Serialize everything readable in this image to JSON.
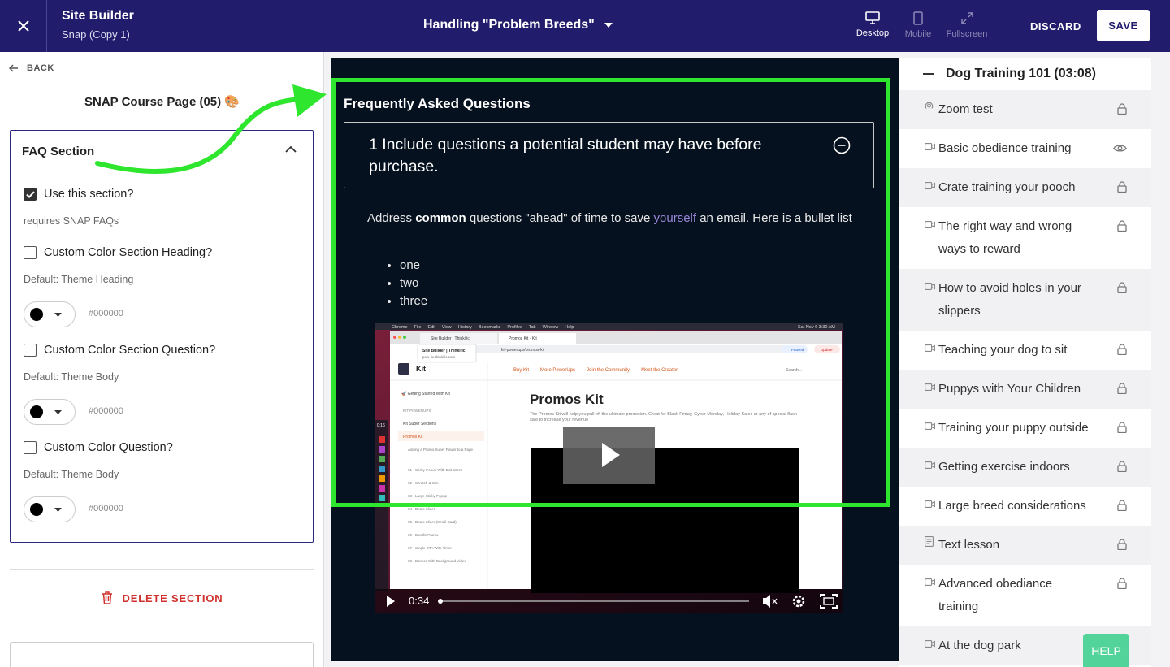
{
  "topbar": {
    "title": "Site Builder",
    "subtitle": "Snap (Copy 1)",
    "page_selector": "Handling \"Problem Breeds\"",
    "views": [
      {
        "label": "Desktop",
        "icon": "desktop-icon",
        "active": true
      },
      {
        "label": "Mobile",
        "icon": "mobile-icon",
        "active": false
      },
      {
        "label": "Fullscreen",
        "icon": "fullscreen-icon",
        "active": false
      }
    ],
    "discard_label": "DISCARD",
    "save_label": "SAVE"
  },
  "left": {
    "back_label": "BACK",
    "page_title": "SNAP Course Page (05) 🎨",
    "section": {
      "title": "FAQ Section",
      "use_section": {
        "label": "Use this section?",
        "checked": true,
        "hint": "requires SNAP FAQs"
      },
      "options": [
        {
          "label": "Custom Color Section Heading?",
          "checked": false,
          "default": "Default: Theme Heading",
          "color": "#000000"
        },
        {
          "label": "Custom Color Section Question?",
          "checked": false,
          "default": "Default: Theme Body",
          "color": "#000000"
        },
        {
          "label": "Custom Color Question?",
          "checked": false,
          "default": "Default: Theme Body",
          "color": "#000000"
        }
      ]
    },
    "delete_label": "DELETE SECTION"
  },
  "preview": {
    "faq_title": "Frequently Asked Questions",
    "question": "1 Include questions a potential student may have before purchase.",
    "answer": {
      "part1": "Address ",
      "bold": "common",
      "part2": " questions \"ahead\" of time to save ",
      "link": "yourself",
      "part3": " an email. Here is a bullet list"
    },
    "bullets": [
      "one",
      "two",
      "three"
    ],
    "video": {
      "time": "0:34",
      "progress": 0.0,
      "page_heading": "Promos Kit",
      "page_desc": "The Promos Kit will help you pull off the ultimate promotion. Great for Black Friday, Cyber Monday, Holiday Sales or any of special flash sale to increase your revenue",
      "menu": [
        "Chrome",
        "File",
        "Edit",
        "View",
        "History",
        "Bookmarks",
        "Profiles",
        "Tab",
        "Window",
        "Help"
      ],
      "clock": "Sat Nov 6  3:30 AM",
      "tabs": [
        "Site Builder | Thinkific",
        "Promos Kit - Kit"
      ],
      "url": "kit-powerups/promos-kit",
      "tooltip_title": "Site Builder | Thinkific",
      "tooltip_url": "pow-fix.thinkific.com",
      "brand": "Kit",
      "nav": [
        "Buy Kit",
        "More PowerUps",
        "Join the Community",
        "Meet the Creator"
      ],
      "search": "Search...",
      "paused": "Paused",
      "update": "Update",
      "side_start": "🚀 Getting Started With Kit",
      "side_heading": "KIT POWERUPS",
      "side_items": [
        "Kit Super Sections",
        "Promos Kit"
      ],
      "side_sub": [
        "Adding a Promo Super Power to a Page",
        "01 - Sticky Popup With Exit Intent",
        "02 - Scratch & Win",
        "03 - Large Sticky Popup",
        "04 - Deals Slider",
        "05 - Deals Slider (Small Card)",
        "06 - Bundle Promo",
        "07 - Single CTA With Timer",
        "08 - Banner With Background Video"
      ],
      "dock_time": "0:16"
    }
  },
  "curriculum": {
    "chapter": "Dog Training 101 (03:08)",
    "lessons": [
      {
        "name": "Zoom test",
        "icon": "zoom-icon",
        "status": "lock-icon"
      },
      {
        "name": "Basic obedience training",
        "icon": "video-icon",
        "status": "eye-icon"
      },
      {
        "name": "Crate training your pooch",
        "icon": "video-icon",
        "status": "lock-icon"
      },
      {
        "name": "The right way and wrong ways to reward",
        "icon": "video-icon",
        "status": "lock-icon"
      },
      {
        "name": "How to avoid holes in your slippers",
        "icon": "video-icon",
        "status": "lock-icon"
      },
      {
        "name": "Teaching your dog to sit",
        "icon": "video-icon",
        "status": "lock-icon"
      },
      {
        "name": "Puppys with Your Children",
        "icon": "video-icon",
        "status": "lock-icon"
      },
      {
        "name": "Training your puppy outside",
        "icon": "video-icon",
        "status": "lock-icon"
      },
      {
        "name": "Getting exercise indoors",
        "icon": "video-icon",
        "status": "lock-icon"
      },
      {
        "name": "Large breed considerations",
        "icon": "video-icon",
        "status": "lock-icon"
      },
      {
        "name": "Text lesson",
        "icon": "text-icon",
        "status": "lock-icon"
      },
      {
        "name": "Advanced obediance training",
        "icon": "video-icon",
        "status": "lock-icon"
      },
      {
        "name": "At the dog park",
        "icon": "video-icon",
        "status": "none"
      }
    ]
  },
  "help_label": "HELP",
  "colors": {
    "topbar": "#211c6b",
    "highlight": "#2ee62e",
    "preview_bg": "#06111f",
    "delete": "#d0312d",
    "help": "#52d39a"
  }
}
